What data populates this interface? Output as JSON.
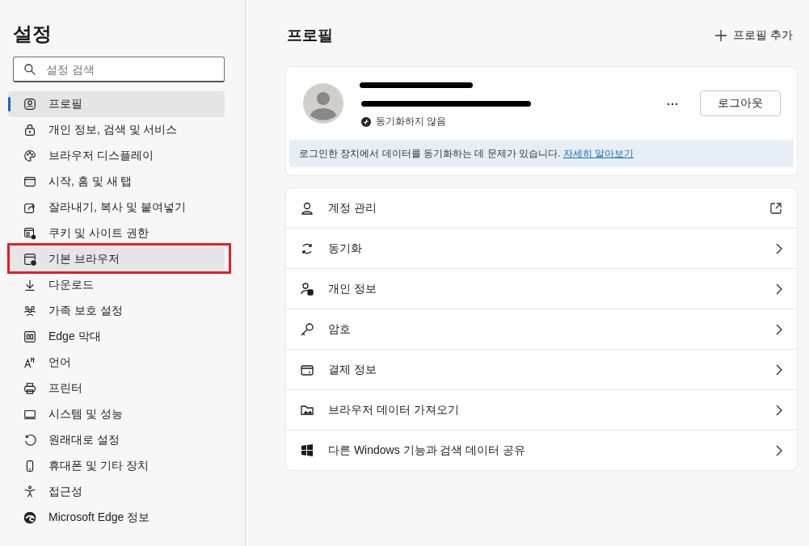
{
  "sidebar": {
    "title": "설정",
    "search": {
      "placeholder": "설정 검색"
    },
    "items": [
      {
        "label": "프로필",
        "selected": true,
        "hovered": false,
        "marked": false
      },
      {
        "label": "개인 정보, 검색 및 서비스",
        "selected": false,
        "hovered": false,
        "marked": false
      },
      {
        "label": "브라우저 디스플레이",
        "selected": false,
        "hovered": false,
        "marked": false
      },
      {
        "label": "시작, 홈 및 새 탭",
        "selected": false,
        "hovered": false,
        "marked": false
      },
      {
        "label": "잘라내기, 복사 및 붙여넣기",
        "selected": false,
        "hovered": false,
        "marked": false
      },
      {
        "label": "쿠키 및 사이트 권한",
        "selected": false,
        "hovered": false,
        "marked": false
      },
      {
        "label": "기본 브라우저",
        "selected": false,
        "hovered": true,
        "marked": true
      },
      {
        "label": "다운로드",
        "selected": false,
        "hovered": false,
        "marked": false
      },
      {
        "label": "가족 보호 설정",
        "selected": false,
        "hovered": false,
        "marked": false
      },
      {
        "label": "Edge 막대",
        "selected": false,
        "hovered": false,
        "marked": false
      },
      {
        "label": "언어",
        "selected": false,
        "hovered": false,
        "marked": false
      },
      {
        "label": "프린터",
        "selected": false,
        "hovered": false,
        "marked": false
      },
      {
        "label": "시스템 및 성능",
        "selected": false,
        "hovered": false,
        "marked": false
      },
      {
        "label": "원래대로 설정",
        "selected": false,
        "hovered": false,
        "marked": false
      },
      {
        "label": "휴대폰 및 기타 장치",
        "selected": false,
        "hovered": false,
        "marked": false
      },
      {
        "label": "접근성",
        "selected": false,
        "hovered": false,
        "marked": false
      },
      {
        "label": "Microsoft Edge 정보",
        "selected": false,
        "hovered": false,
        "marked": false
      }
    ]
  },
  "main": {
    "title": "프로필",
    "add_profile": "프로필 추가",
    "profile": {
      "redacted": true,
      "sync_status": "동기화하지 않음",
      "more": "···",
      "logout": "로그아웃",
      "notice": {
        "text": "로그인한 장치에서 데이터를 동기화하는 데 문제가 있습니다.",
        "link": "자세히 알아보기"
      }
    },
    "rows": [
      {
        "label": "계정 관리",
        "kind": "external"
      },
      {
        "label": "동기화",
        "kind": "nav"
      },
      {
        "label": "개인 정보",
        "kind": "nav"
      },
      {
        "label": "암호",
        "kind": "nav"
      },
      {
        "label": "결제 정보",
        "kind": "nav"
      },
      {
        "label": "브라우저 데이터 가져오기",
        "kind": "nav"
      },
      {
        "label": "다른 Windows 기능과 검색 데이터 공유",
        "kind": "nav"
      }
    ]
  }
}
